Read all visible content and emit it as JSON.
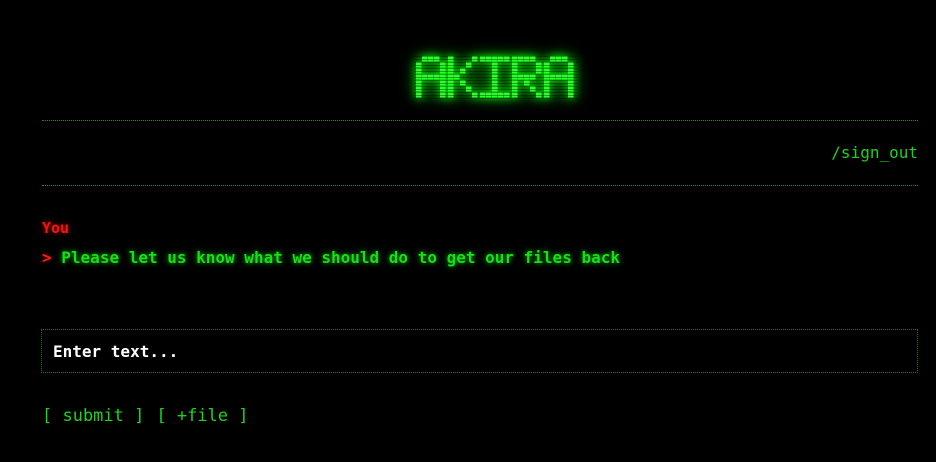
{
  "header": {
    "logo_text": "AKIRA",
    "sign_out_label": "/sign_out"
  },
  "chat": {
    "author": "You",
    "prompt_symbol": ">",
    "message": "Please let us know what we should do to get our files back"
  },
  "composer": {
    "placeholder": "Enter text...",
    "value": ""
  },
  "actions": {
    "submit_label": "[ submit ]",
    "file_label": "[ +file ]"
  },
  "colors": {
    "background": "#000000",
    "accent_green": "#1cd41c",
    "author_red": "#ff1010",
    "input_text": "#ffffff"
  }
}
